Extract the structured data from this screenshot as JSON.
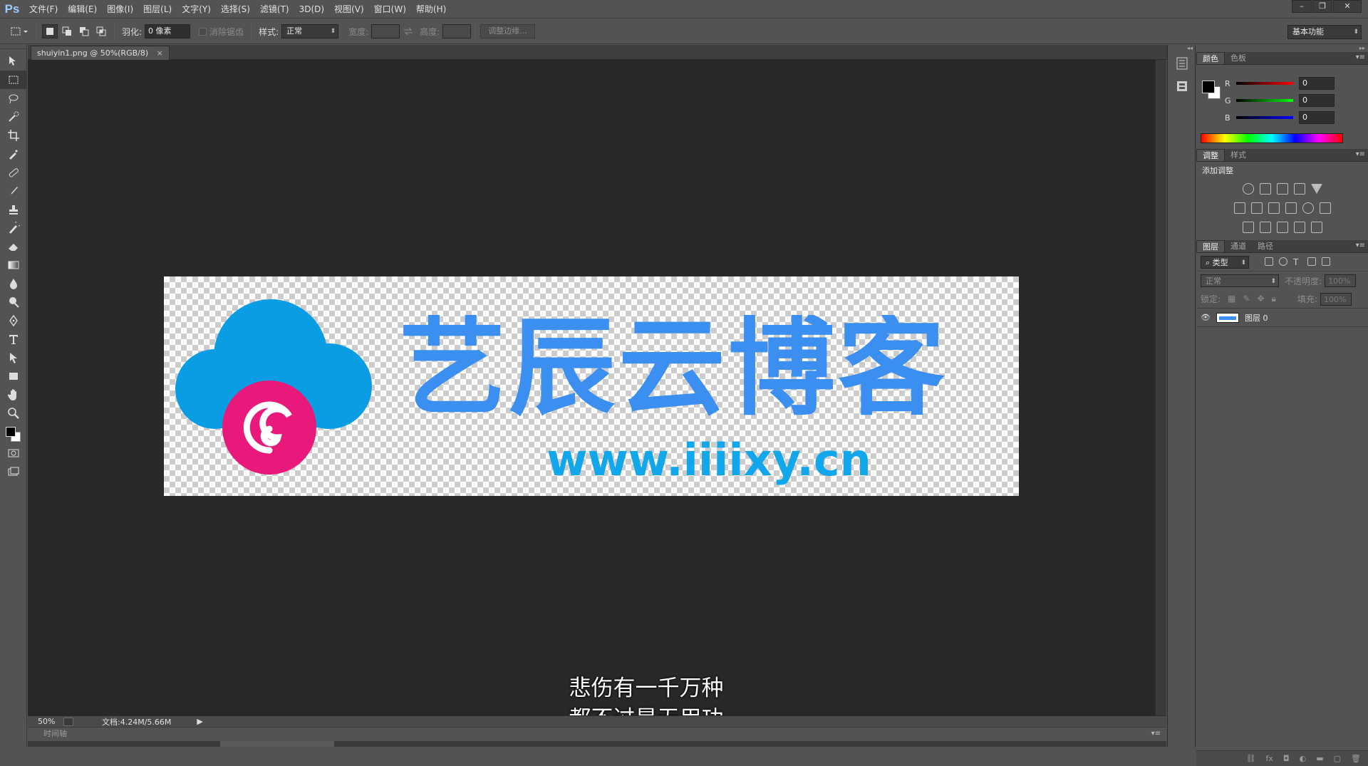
{
  "app": {
    "logo": "Ps"
  },
  "menu": [
    "文件(F)",
    "编辑(E)",
    "图像(I)",
    "图层(L)",
    "文字(Y)",
    "选择(S)",
    "滤镜(T)",
    "3D(D)",
    "视图(V)",
    "窗口(W)",
    "帮助(H)"
  ],
  "window_controls": {
    "minimize": "–",
    "restore": "❐",
    "close": "✕"
  },
  "options": {
    "feather_label": "羽化:",
    "feather_value": "0 像素",
    "antialias_label": "消除锯齿",
    "style_label": "样式:",
    "style_value": "正常",
    "width_label": "宽度:",
    "height_label": "高度:",
    "refine_edge_label": "调整边缘...",
    "workspace": "基本功能"
  },
  "document": {
    "tab_title": "shuiyin1.png @ 50%(RGB/8)",
    "tab_close": "×",
    "zoom": "50%",
    "doc_info": "文档:4.24M/5.66M",
    "timeline_label": "时间轴",
    "image_title": "艺辰云博客",
    "image_url": "www.iiiixy.cn"
  },
  "subtitles": [
    "悲伤有一千万种",
    "都不过是无用功"
  ],
  "panels": {
    "color": {
      "tabs": [
        "颜色",
        "色板"
      ],
      "channels": [
        {
          "label": "R",
          "value": "0",
          "color": "#ff0000"
        },
        {
          "label": "G",
          "value": "0",
          "color": "#00ff00"
        },
        {
          "label": "B",
          "value": "0",
          "color": "#0000ff"
        }
      ]
    },
    "adjustments": {
      "tabs": [
        "调整",
        "样式"
      ],
      "title": "添加调整"
    },
    "layers": {
      "tabs": [
        "图层",
        "通道",
        "路径"
      ],
      "filter_kind": "类型",
      "blend_mode": "正常",
      "opacity_label": "不透明度:",
      "opacity_value": "100%",
      "lock_label": "锁定:",
      "fill_label": "填充:",
      "fill_value": "100%",
      "layer_name": "图层 0"
    }
  },
  "colors": {
    "logo_cloud": "#0a9de3",
    "logo_spiral": "#e8197a",
    "logo_text": "#3a8ff0",
    "logo_url": "#12a6ea"
  }
}
